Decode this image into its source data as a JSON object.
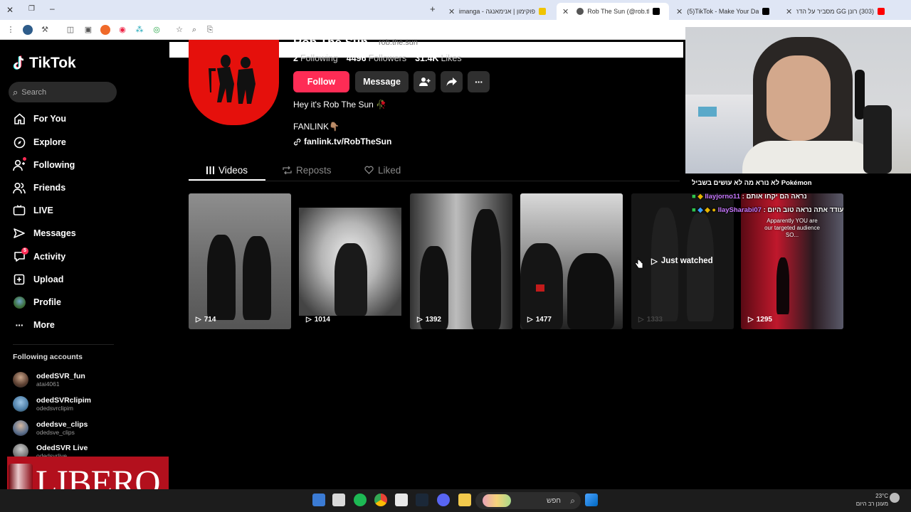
{
  "browser": {
    "tabs": [
      {
        "title": "פוקימון | אנימאנגה - Animanga",
        "active": false,
        "fav_color": "#f0c400"
      },
      {
        "title": "Rob The Sun (@rob.the.sun)",
        "active": true,
        "fav_color": "#000000"
      },
      {
        "title": "(5)TikTok - Make Your Day",
        "active": false,
        "fav_color": "#000000"
      },
      {
        "title": "(303) רונן GG מסביר על הדרמה",
        "active": false,
        "fav_color": "#ff0000"
      }
    ],
    "new_tab_label": "+"
  },
  "sidebar": {
    "logo": "TikTok",
    "search_placeholder": "Search",
    "nav": [
      {
        "label": "For You",
        "icon": "home-icon"
      },
      {
        "label": "Explore",
        "icon": "compass-icon"
      },
      {
        "label": "Following",
        "icon": "following-icon"
      },
      {
        "label": "Friends",
        "icon": "friends-icon"
      },
      {
        "label": "LIVE",
        "icon": "live-icon"
      },
      {
        "label": "Messages",
        "icon": "messages-icon"
      },
      {
        "label": "Activity",
        "icon": "activity-icon",
        "badge": "5"
      },
      {
        "label": "Upload",
        "icon": "upload-icon"
      },
      {
        "label": "Profile",
        "icon": "profile-icon"
      },
      {
        "label": "More",
        "icon": "more-icon"
      }
    ],
    "following_heading": "Following accounts",
    "accounts": [
      {
        "name": "odedSVR_fun",
        "handle": "atai4061"
      },
      {
        "name": "odedSVRclipim",
        "handle": "odedsvrclipim"
      },
      {
        "name": "odedsve_clips",
        "handle": "odedsve_clips"
      },
      {
        "name": "OdedSVR Live",
        "handle": "odedsvrlive"
      }
    ]
  },
  "profile": {
    "name": "Rob The Sun",
    "handle": "rob.the.sun",
    "following_count": "2",
    "following_label": "Following",
    "followers_count": "4496",
    "followers_label": "Followers",
    "likes_count": "31.4K",
    "likes_label": "Likes",
    "follow_button": "Follow",
    "message_button": "Message",
    "bio": "Hey it's Rob The Sun 🥀",
    "fanlink_label": "FANLINK👇🏽",
    "link": "fanlink.tv/RobTheSun"
  },
  "tabs": {
    "videos": "Videos",
    "reposts": "Reposts",
    "liked": "Liked"
  },
  "videos": [
    {
      "views": "714"
    },
    {
      "views": "1014"
    },
    {
      "views": "1392"
    },
    {
      "views": "1477"
    },
    {
      "views": "1333",
      "overlay": "Just watched"
    },
    {
      "views": "1295",
      "caption": "Apparently YOU are our targeted audience SO..."
    }
  ],
  "chat": {
    "line1": "Pokémon לא נורא מה לא עושים בשביל",
    "line2_user": "Ilayjorno11",
    "line2_text": ": נראה הם יקחו אותם",
    "line3_user": "IlaySharabi07",
    "line3_text": ": עודד אתה נראה טוב היום"
  },
  "overlay": {
    "libero": "LIBERO"
  },
  "taskbar": {
    "search_label": "חפש",
    "temperature": "23°C",
    "weather": "מעונן רב היום"
  },
  "colors": {
    "accent": "#fe2c55",
    "background": "#000000"
  }
}
